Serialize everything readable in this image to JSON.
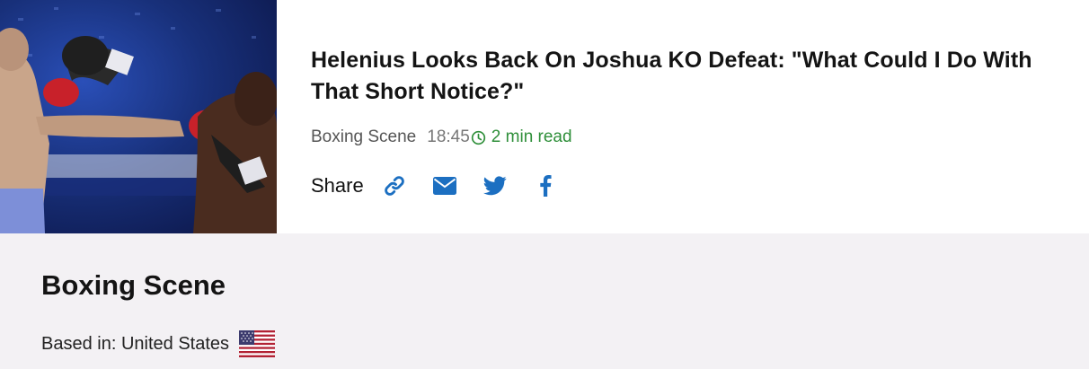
{
  "article": {
    "headline": "Helenius Looks Back On Joshua KO Defeat: \"What Could I Do With That Short Notice?\"",
    "source": "Boxing Scene",
    "time": "18:45",
    "read_time": "2 min read"
  },
  "share": {
    "label": "Share",
    "buttons": [
      "link-icon",
      "email-icon",
      "twitter-icon",
      "facebook-icon"
    ],
    "color": "#1c6fc1"
  },
  "source_info": {
    "name": "Boxing Scene",
    "based_in": "Based in: United States"
  },
  "colors": {
    "accent_green": "#2f8f3a",
    "share_blue": "#1c6fc1",
    "panel_bg": "#f3f1f4"
  }
}
